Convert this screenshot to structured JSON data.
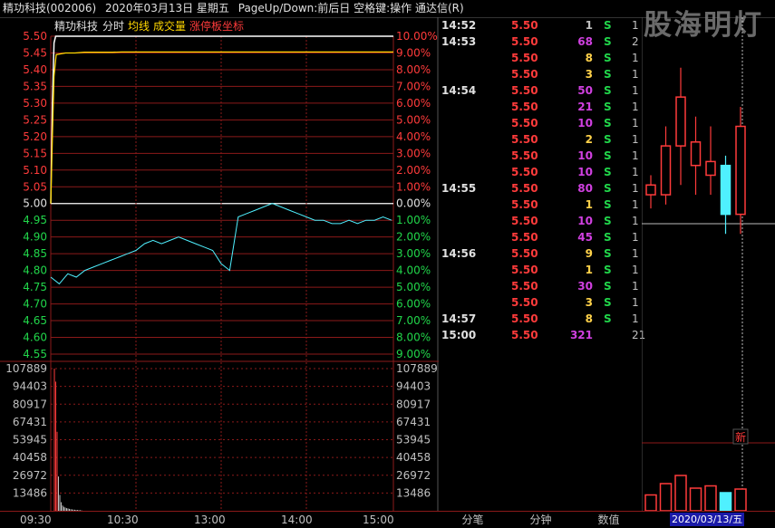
{
  "header": {
    "stock": "精功科技(002006)",
    "date": "2020年03月13日 星期五",
    "hint": "PageUp/Down:前后日 空格键:操作 通达信(R)"
  },
  "chart_header": {
    "name": "精功科技",
    "tab_intraday": "分时",
    "tab_avg": "均线",
    "tab_volume": "成交量",
    "tab_limit": "涨停板坐标"
  },
  "watermark": "股海明灯",
  "colors": {
    "up": "#ff3b3b",
    "down": "#21d64a",
    "price_line": "#ffffff",
    "avg_line": "#ffd700",
    "grid": "#8b1a1a",
    "purple": "#d040e0",
    "cyan": "#4ff0ff"
  },
  "chart_data": {
    "type": "line",
    "prev_close": 5.0,
    "price_ticks": [
      "5.50",
      "5.45",
      "5.40",
      "5.35",
      "5.30",
      "5.25",
      "5.20",
      "5.15",
      "5.10",
      "5.05",
      "5.00",
      "4.95",
      "4.90",
      "4.85",
      "4.80",
      "4.75",
      "4.70",
      "4.65",
      "4.60",
      "4.55"
    ],
    "pct_ticks": [
      "10.00%",
      "9.00%",
      "8.00%",
      "7.00%",
      "6.00%",
      "5.00%",
      "4.00%",
      "3.00%",
      "2.00%",
      "1.00%",
      "0.00%",
      "1.00%",
      "2.00%",
      "3.00%",
      "4.00%",
      "5.00%",
      "6.00%",
      "7.00%",
      "8.00%",
      "9.00%"
    ],
    "volume_ticks": [
      "107889",
      "94403",
      "80917",
      "67431",
      "53945",
      "40458",
      "26972",
      "13486"
    ],
    "time_ticks": [
      "09:30",
      "10:30",
      "13:00",
      "14:00",
      "15:00"
    ],
    "series": [
      {
        "values": [
          5.0,
          5.3,
          5.48,
          5.5,
          5.5,
          5.5,
          5.5,
          5.5,
          5.5,
          5.5,
          5.5,
          5.5,
          5.5,
          5.5,
          5.5,
          5.5,
          5.5,
          5.5,
          5.5,
          5.5,
          5.5,
          5.5,
          5.5,
          5.5,
          5.5,
          5.5,
          5.5,
          5.5,
          5.5,
          5.5,
          5.5,
          5.5,
          5.5,
          5.5,
          5.5,
          5.5,
          5.5,
          5.5,
          5.5,
          5.5,
          5.5
        ]
      },
      {
        "values": [
          5.0,
          5.2,
          5.38,
          5.43,
          5.445,
          5.45,
          5.45,
          5.452,
          5.452,
          5.452,
          5.452,
          5.453,
          5.453,
          5.453,
          5.453,
          5.453,
          5.453,
          5.453,
          5.453,
          5.453,
          5.453,
          5.453,
          5.453,
          5.453,
          5.453,
          5.453,
          5.453,
          5.453,
          5.453,
          5.453,
          5.453,
          5.453,
          5.453,
          5.453,
          5.453,
          5.453,
          5.453,
          5.453,
          5.453,
          5.453,
          5.453
        ]
      },
      {
        "values": [
          4.78,
          4.76,
          4.79,
          4.78,
          4.8,
          4.81,
          4.82,
          4.83,
          4.84,
          4.85,
          4.86,
          4.88,
          4.89,
          4.88,
          4.89,
          4.9,
          4.89,
          4.88,
          4.87,
          4.86,
          4.82,
          4.8,
          4.96,
          4.97,
          4.98,
          4.99,
          5.0,
          4.99,
          4.98,
          4.97,
          4.96,
          4.95,
          4.95,
          4.94,
          4.94,
          4.95,
          4.94,
          4.95,
          4.95,
          4.96,
          4.95
        ]
      }
    ],
    "volume": [
      107889,
      98000,
      60000,
      26000,
      12000,
      6500,
      4000,
      3000,
      2500,
      2000,
      1800,
      1500,
      1200,
      1000,
      900,
      800,
      700,
      600,
      500,
      400,
      300
    ]
  },
  "trades": [
    {
      "time": "14:52",
      "price": "5.50",
      "vol": "1",
      "side": "S",
      "count": "1",
      "color": "#c0c0c0"
    },
    {
      "time": "14:53",
      "price": "5.50",
      "vol": "68",
      "side": "S",
      "count": "2",
      "color": "#d040e0"
    },
    {
      "time": "",
      "price": "5.50",
      "vol": "8",
      "side": "S",
      "count": "1",
      "color": "#ffd24a"
    },
    {
      "time": "",
      "price": "5.50",
      "vol": "3",
      "side": "S",
      "count": "1",
      "color": "#ffd24a"
    },
    {
      "time": "14:54",
      "price": "5.50",
      "vol": "50",
      "side": "S",
      "count": "1",
      "color": "#d040e0"
    },
    {
      "time": "",
      "price": "5.50",
      "vol": "21",
      "side": "S",
      "count": "1",
      "color": "#d040e0"
    },
    {
      "time": "",
      "price": "5.50",
      "vol": "10",
      "side": "S",
      "count": "1",
      "color": "#d040e0"
    },
    {
      "time": "",
      "price": "5.50",
      "vol": "2",
      "side": "S",
      "count": "1",
      "color": "#ffd24a"
    },
    {
      "time": "",
      "price": "5.50",
      "vol": "10",
      "side": "S",
      "count": "1",
      "color": "#d040e0"
    },
    {
      "time": "",
      "price": "5.50",
      "vol": "10",
      "side": "S",
      "count": "1",
      "color": "#d040e0"
    },
    {
      "time": "14:55",
      "price": "5.50",
      "vol": "80",
      "side": "S",
      "count": "1",
      "color": "#d040e0"
    },
    {
      "time": "",
      "price": "5.50",
      "vol": "1",
      "side": "S",
      "count": "1",
      "color": "#ffd24a"
    },
    {
      "time": "",
      "price": "5.50",
      "vol": "10",
      "side": "S",
      "count": "1",
      "color": "#d040e0"
    },
    {
      "time": "",
      "price": "5.50",
      "vol": "45",
      "side": "S",
      "count": "1",
      "color": "#d040e0"
    },
    {
      "time": "14:56",
      "price": "5.50",
      "vol": "9",
      "side": "S",
      "count": "1",
      "color": "#ffd24a"
    },
    {
      "time": "",
      "price": "5.50",
      "vol": "1",
      "side": "S",
      "count": "1",
      "color": "#ffd24a"
    },
    {
      "time": "",
      "price": "5.50",
      "vol": "30",
      "side": "S",
      "count": "1",
      "color": "#d040e0"
    },
    {
      "time": "",
      "price": "5.50",
      "vol": "3",
      "side": "S",
      "count": "1",
      "color": "#ffd24a"
    },
    {
      "time": "14:57",
      "price": "5.50",
      "vol": "8",
      "side": "S",
      "count": "1",
      "color": "#ffd24a"
    },
    {
      "time": "15:00",
      "price": "5.50",
      "vol": "321",
      "side": "",
      "count": "21",
      "color": "#d040e0"
    }
  ],
  "kline": {
    "candles": [
      {
        "o": 5.05,
        "c": 5.1,
        "h": 5.15,
        "l": 4.98,
        "up": true
      },
      {
        "o": 5.05,
        "c": 5.3,
        "h": 5.4,
        "l": 5.0,
        "up": true
      },
      {
        "o": 5.3,
        "c": 5.55,
        "h": 5.7,
        "l": 5.1,
        "up": true
      },
      {
        "o": 5.2,
        "c": 5.32,
        "h": 5.45,
        "l": 5.05,
        "up": true
      },
      {
        "o": 5.15,
        "c": 5.22,
        "h": 5.4,
        "l": 5.05,
        "up": true
      },
      {
        "o": 5.2,
        "c": 4.95,
        "h": 5.25,
        "l": 4.85,
        "up": false
      },
      {
        "o": 4.95,
        "c": 5.4,
        "h": 5.5,
        "l": 4.85,
        "up": true
      }
    ],
    "volumes": [
      0.35,
      0.6,
      0.78,
      0.5,
      0.55,
      0.4,
      0.48
    ],
    "marker": "新",
    "date": "2020/03/13/五"
  },
  "bottom": {
    "tab1": "分笔",
    "tab2": "分钟",
    "tab3": "数值"
  }
}
